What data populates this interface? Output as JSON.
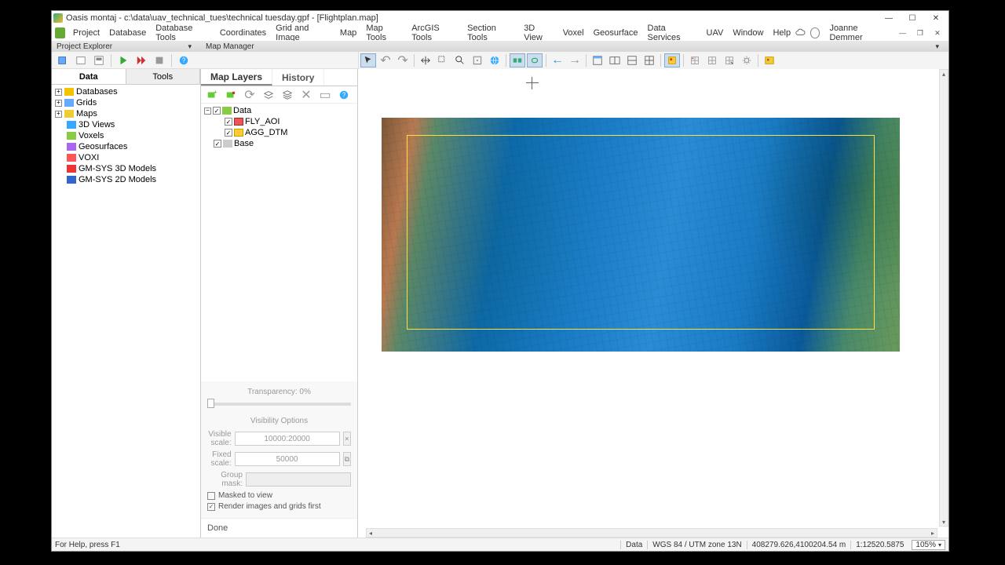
{
  "window": {
    "title": "Oasis montaj - c:\\data\\uav_technical_tues\\technical tuesday.gpf - [Flightplan.map]"
  },
  "menu": {
    "items": [
      "Project",
      "Database",
      "Database Tools",
      "Coordinates",
      "Grid and Image",
      "Map",
      "Map Tools",
      "ArcGIS Tools",
      "Section Tools",
      "3D View",
      "Voxel",
      "Geosurface",
      "Data Services",
      "UAV",
      "Window",
      "Help"
    ],
    "user": "Joanne Demmer"
  },
  "panels": {
    "project_explorer": "Project Explorer",
    "map_manager": "Map Manager"
  },
  "pe": {
    "tabs": {
      "data": "Data",
      "tools": "Tools"
    },
    "nodes": {
      "databases": "Databases",
      "grids": "Grids",
      "maps": "Maps",
      "views3d": "3D Views",
      "voxels": "Voxels",
      "geosurfaces": "Geosurfaces",
      "voxi": "VOXI",
      "gmsys3d": "GM-SYS 3D Models",
      "gmsys2d": "GM-SYS 2D Models"
    }
  },
  "mm": {
    "tabs": {
      "layers": "Map Layers",
      "history": "History"
    },
    "tree": {
      "data": "Data",
      "fly_aoi": "FLY_AOI",
      "agg_dtm": "AGG_DTM",
      "base": "Base"
    },
    "transparency_label": "Transparency: 0%",
    "visibility_label": "Visibility Options",
    "visible_scale_label": "Visible scale:",
    "visible_scale_value": "10000:20000",
    "fixed_scale_label": "Fixed scale:",
    "fixed_scale_value": "50000",
    "group_mask_label": "Group mask:",
    "masked_to_view": "Masked to view",
    "render_first": "Render images and grids first",
    "done": "Done"
  },
  "status": {
    "help": "For Help, press F1",
    "frame": "Data",
    "cs": "WGS 84 / UTM zone 13N",
    "coords": "408279.626,4100204.54 m",
    "scale": "1:12520.5875",
    "zoom": "105%"
  }
}
